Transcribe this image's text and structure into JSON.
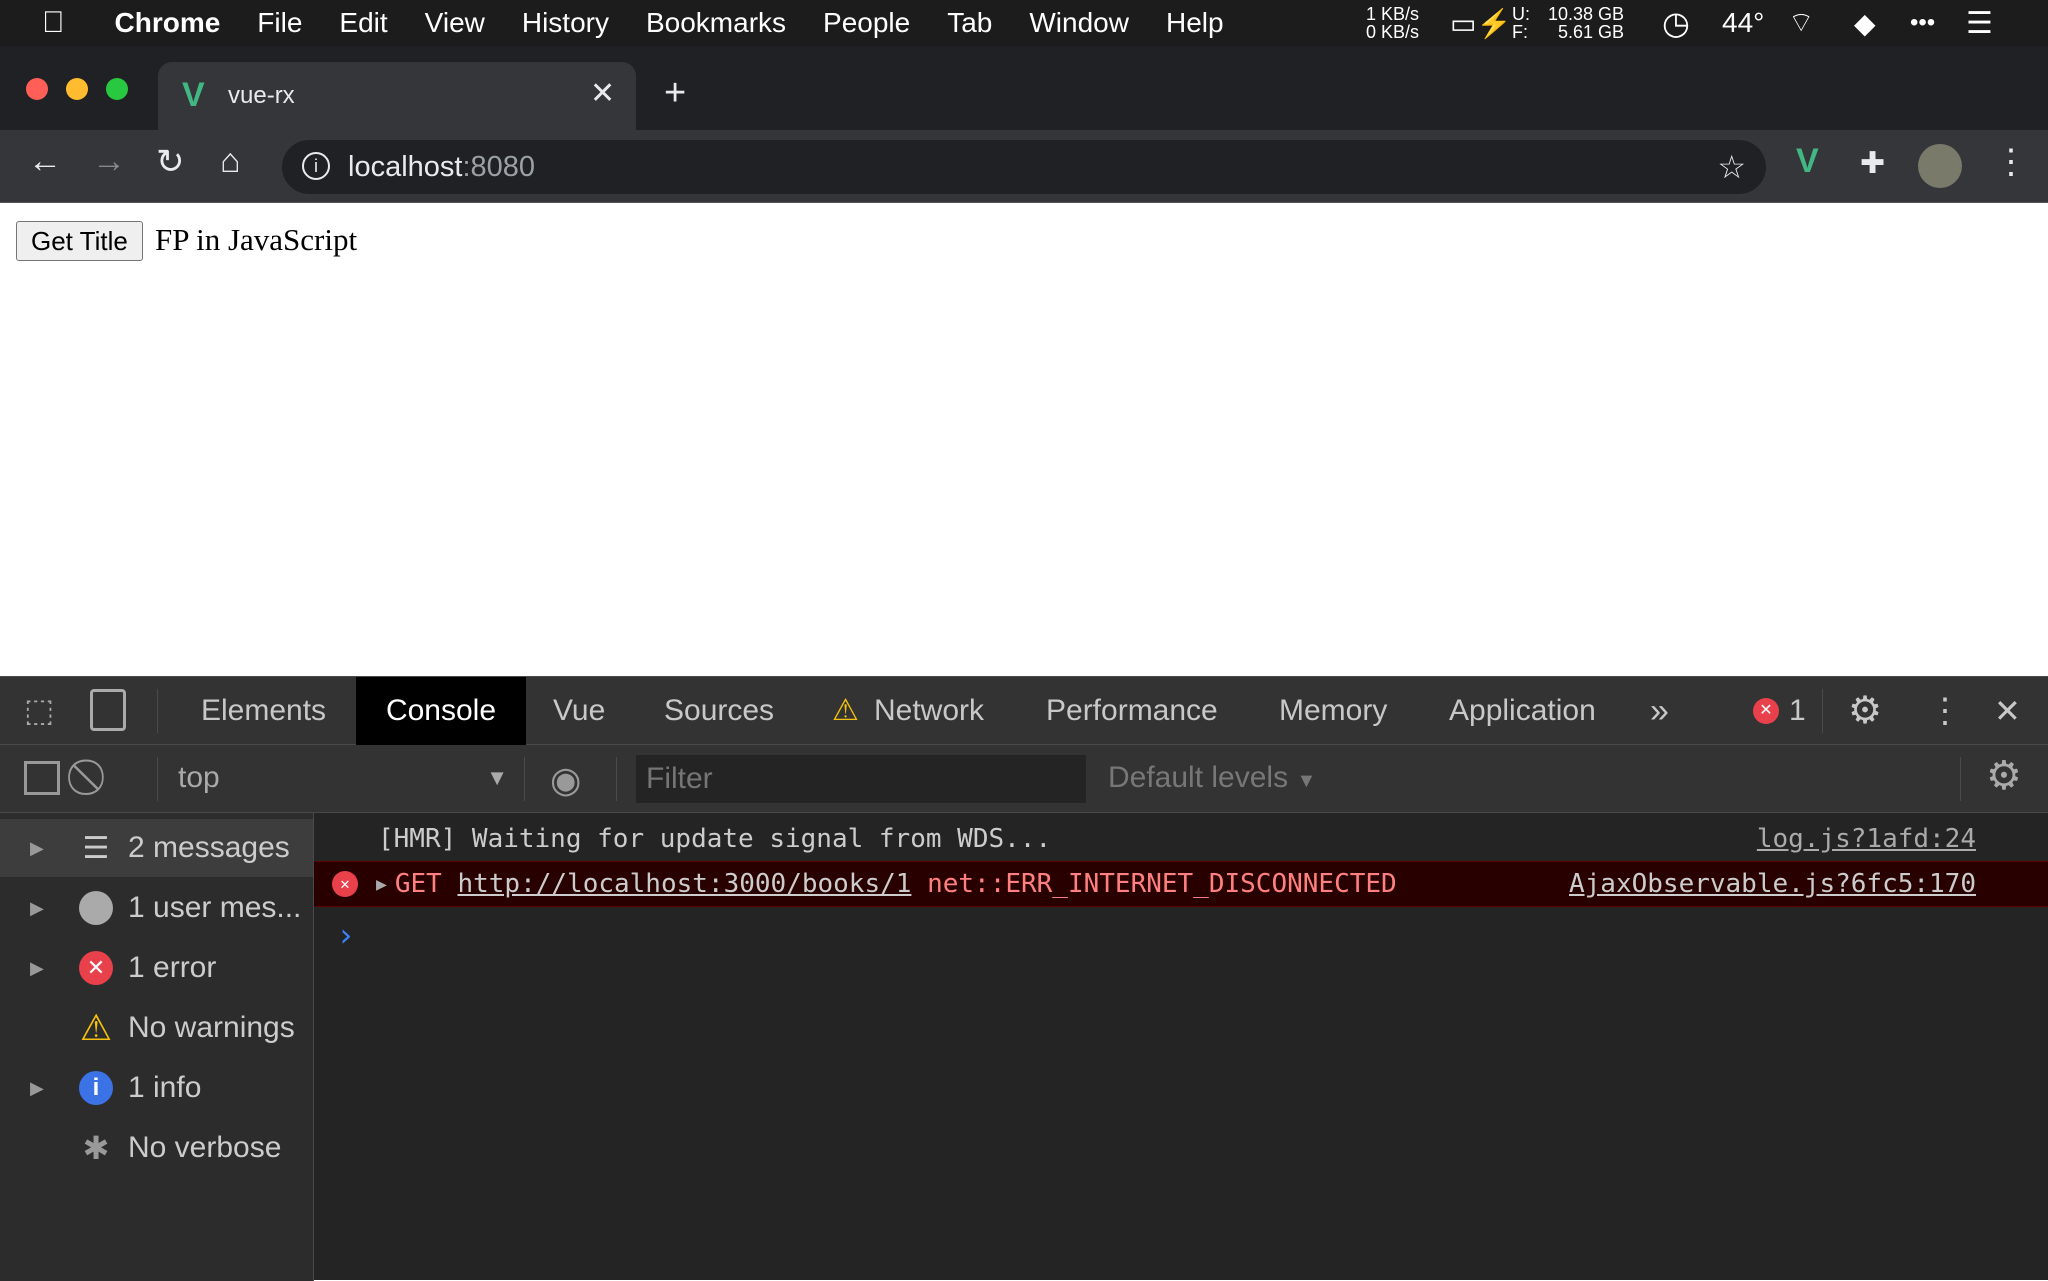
{
  "menubar": {
    "app": "Chrome",
    "items": [
      "File",
      "Edit",
      "View",
      "History",
      "Bookmarks",
      "People",
      "Tab",
      "Window",
      "Help"
    ],
    "net_up": "1 KB/s",
    "net_down": "0 KB/s",
    "disk_u_label": "U:",
    "disk_u": "10.38 GB",
    "disk_f_label": "F:",
    "disk_f": "5.61 GB",
    "temp": "44°"
  },
  "tab": {
    "title": "vue-rx"
  },
  "omnibox": {
    "host": "localhost",
    "port": ":8080"
  },
  "page": {
    "button": "Get Title",
    "title": "FP in JavaScript"
  },
  "devtools": {
    "tabs": [
      "Elements",
      "Console",
      "Vue",
      "Sources",
      "Network",
      "Performance",
      "Memory",
      "Application"
    ],
    "active_tab": "Console",
    "error_count": "1",
    "context": "top",
    "filter_placeholder": "Filter",
    "levels": "Default levels",
    "sidebar": [
      {
        "label": "2 messages",
        "icon": "list-icon"
      },
      {
        "label": "1 user mes...",
        "icon": "user-icon"
      },
      {
        "label": "1 error",
        "icon": "error-icon"
      },
      {
        "label": "No warnings",
        "icon": "warning-icon"
      },
      {
        "label": "1 info",
        "icon": "info-icon"
      },
      {
        "label": "No verbose",
        "icon": "bug-icon"
      }
    ],
    "messages": [
      {
        "text": "[HMR] Waiting for update signal from WDS...",
        "source": "log.js?1afd:24"
      },
      {
        "method": "GET",
        "url": "http://localhost:3000/books/1",
        "error": "net::ERR_INTERNET_DISCONNECTED",
        "source": "AjaxObservable.js?6fc5:170"
      }
    ],
    "prompt": "›"
  },
  "colors": {
    "error_bg": "#290000",
    "error_text": "#ff8080",
    "accent_vue": "#41b883"
  }
}
